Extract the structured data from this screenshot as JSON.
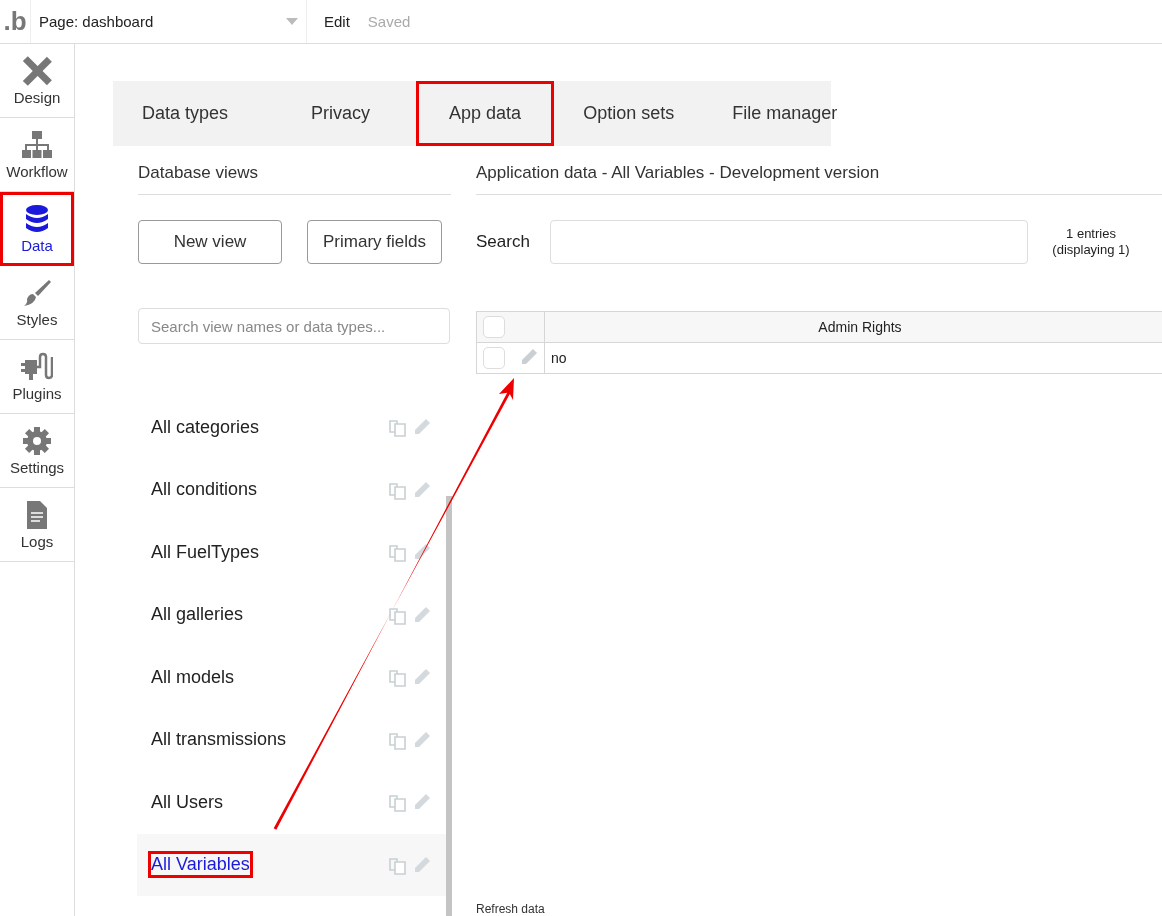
{
  "topbar": {
    "logo": ".b",
    "page_selector": "Page: dashboard",
    "mode": "Edit",
    "status": "Saved"
  },
  "sidebar": {
    "items": [
      {
        "kind": "design",
        "label": "Design",
        "selected": false,
        "highlighted": false
      },
      {
        "kind": "workflow",
        "label": "Workflow",
        "selected": false,
        "highlighted": false
      },
      {
        "kind": "data",
        "label": "Data",
        "selected": true,
        "highlighted": true
      },
      {
        "kind": "styles",
        "label": "Styles",
        "selected": false,
        "highlighted": false
      },
      {
        "kind": "plugins",
        "label": "Plugins",
        "selected": false,
        "highlighted": false
      },
      {
        "kind": "settings",
        "label": "Settings",
        "selected": false,
        "highlighted": false
      },
      {
        "kind": "logs",
        "label": "Logs",
        "selected": false,
        "highlighted": false
      }
    ]
  },
  "tabs": [
    {
      "label": "Data types",
      "highlighted": false
    },
    {
      "label": "Privacy",
      "highlighted": false
    },
    {
      "label": "App data",
      "highlighted": true
    },
    {
      "label": "Option sets",
      "highlighted": false
    },
    {
      "label": "File manager",
      "highlighted": false
    }
  ],
  "views_panel": {
    "title": "Database views",
    "buttons": [
      "New view",
      "Primary fields"
    ],
    "search": {
      "placeholder": "Search view names or data types..."
    },
    "items": [
      {
        "label": "All categories",
        "selected": false,
        "highlighted": false
      },
      {
        "label": "All conditions",
        "selected": false,
        "highlighted": false
      },
      {
        "label": "All FuelTypes",
        "selected": false,
        "highlighted": false
      },
      {
        "label": "All galleries",
        "selected": false,
        "highlighted": false
      },
      {
        "label": "All models",
        "selected": false,
        "highlighted": false
      },
      {
        "label": "All transmissions",
        "selected": false,
        "highlighted": false
      },
      {
        "label": "All Users",
        "selected": false,
        "highlighted": false
      },
      {
        "label": "All Variables",
        "selected": true,
        "highlighted": true
      }
    ]
  },
  "data_panel": {
    "title": "Application data - All Variables - Development version",
    "search_label": "Search",
    "count": "1 entries",
    "count_detail": "(displaying 1)",
    "table": {
      "select_all_checked": false,
      "columns": [
        "Admin Rights"
      ],
      "rows": [
        {
          "checked": false,
          "cells": [
            "no"
          ]
        }
      ]
    },
    "footer": "Refresh data"
  }
}
